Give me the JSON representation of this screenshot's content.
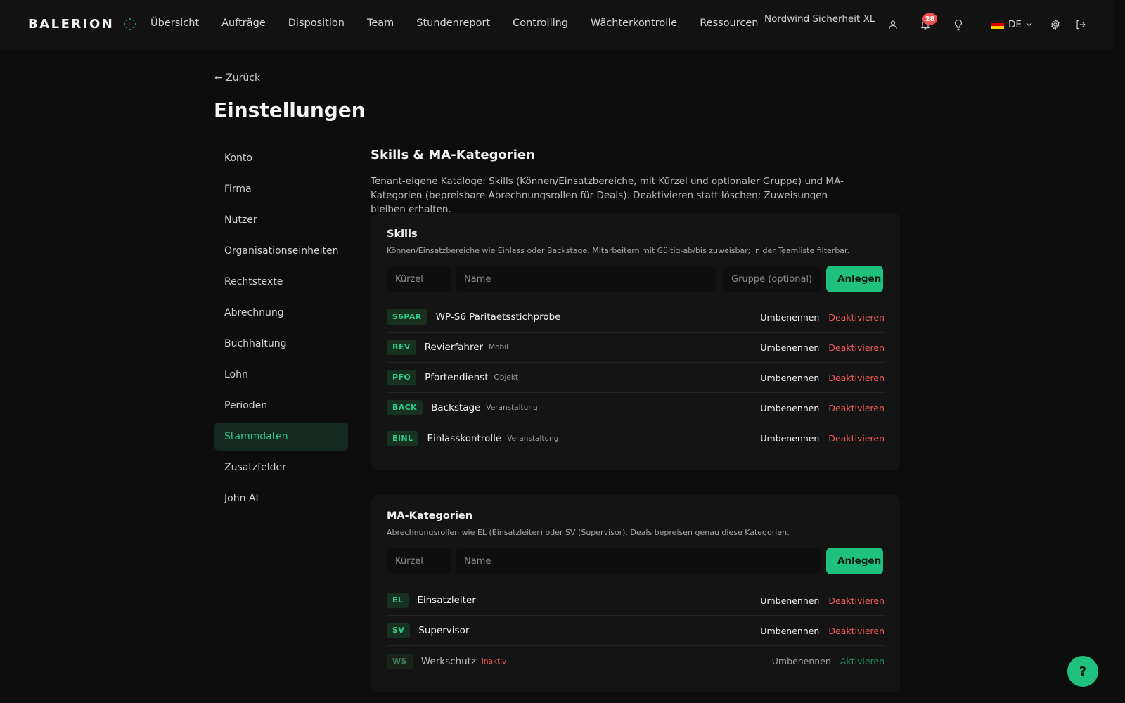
{
  "brand": {
    "name": "BALERION"
  },
  "nav": [
    {
      "label": "Übersicht",
      "id": "uebersicht"
    },
    {
      "label": "Aufträge",
      "id": "auftraege"
    },
    {
      "label": "Disposition",
      "id": "disposition"
    },
    {
      "label": "Team",
      "id": "team"
    },
    {
      "label": "Stundenreport",
      "id": "stundenreport"
    },
    {
      "label": "Controlling",
      "id": "controlling"
    },
    {
      "label": "Wächterkontrolle",
      "id": "waechterkontrolle"
    },
    {
      "label": "Ressourcen",
      "id": "ressourcen"
    }
  ],
  "header": {
    "tenant": "Nordwind Sicherheit XL",
    "notifications_count": "28",
    "language": "DE"
  },
  "back_label": "← Zurück",
  "page_title": "Einstellungen",
  "sidenav": [
    {
      "label": "Konto",
      "active": false
    },
    {
      "label": "Firma",
      "active": false
    },
    {
      "label": "Nutzer",
      "active": false
    },
    {
      "label": "Organisationseinheiten",
      "active": false
    },
    {
      "label": "Rechtstexte",
      "active": false
    },
    {
      "label": "Abrechnung",
      "active": false
    },
    {
      "label": "Buchhaltung",
      "active": false
    },
    {
      "label": "Lohn",
      "active": false
    },
    {
      "label": "Perioden",
      "active": false
    },
    {
      "label": "Stammdaten",
      "active": true
    },
    {
      "label": "Zusatzfelder",
      "active": false
    },
    {
      "label": "John AI",
      "active": false
    }
  ],
  "section": {
    "title": "Skills & MA-Kategorien",
    "description": "Tenant-eigene Kataloge: Skills (Können/Einsatzbereiche, mit Kürzel und optionaler Gruppe) und MA-Kategorien (bepreisbare Abrechnungsrollen für Deals). Deaktivieren statt löschen: Zuweisungen bleiben erhalten."
  },
  "skills": {
    "title": "Skills",
    "description": "Können/Einsatzbereiche wie Einlass oder Backstage. Mitarbeitern mit Gültig-ab/bis zuweisbar; in der Teamliste filterbar.",
    "placeholder_code": "Kürzel",
    "placeholder_name": "Name",
    "placeholder_group": "Gruppe (optional)",
    "add_label": "Anlegen",
    "rename_label": "Umbenennen",
    "deactivate_label": "Deaktivieren",
    "items": [
      {
        "code": "S6PAR",
        "name": "WP-S6 Paritaetsstichprobe",
        "group": ""
      },
      {
        "code": "REV",
        "name": "Revierfahrer",
        "group": "Mobil"
      },
      {
        "code": "PFO",
        "name": "Pfortendienst",
        "group": "Objekt"
      },
      {
        "code": "BACK",
        "name": "Backstage",
        "group": "Veranstaltung"
      },
      {
        "code": "EINL",
        "name": "Einlasskontrolle",
        "group": "Veranstaltung"
      }
    ]
  },
  "categories": {
    "title": "MA-Kategorien",
    "description": "Abrechnungsrollen wie EL (Einsatzleiter) oder SV (Supervisor). Deals bepreisen genau diese Kategorien.",
    "placeholder_code": "Kürzel",
    "placeholder_name": "Name",
    "add_label": "Anlegen",
    "rename_label": "Umbenennen",
    "deactivate_label": "Deaktivieren",
    "activate_label": "Aktivieren",
    "inactive_label": "inaktiv",
    "items": [
      {
        "code": "EL",
        "name": "Einsatzleiter",
        "active": true
      },
      {
        "code": "SV",
        "name": "Supervisor",
        "active": true
      },
      {
        "code": "WS",
        "name": "Werkschutz",
        "active": false
      }
    ]
  },
  "help_label": "?",
  "colors": {
    "accent": "#1ec27e",
    "danger": "#f05a5a",
    "background": "#0d0d0d"
  }
}
